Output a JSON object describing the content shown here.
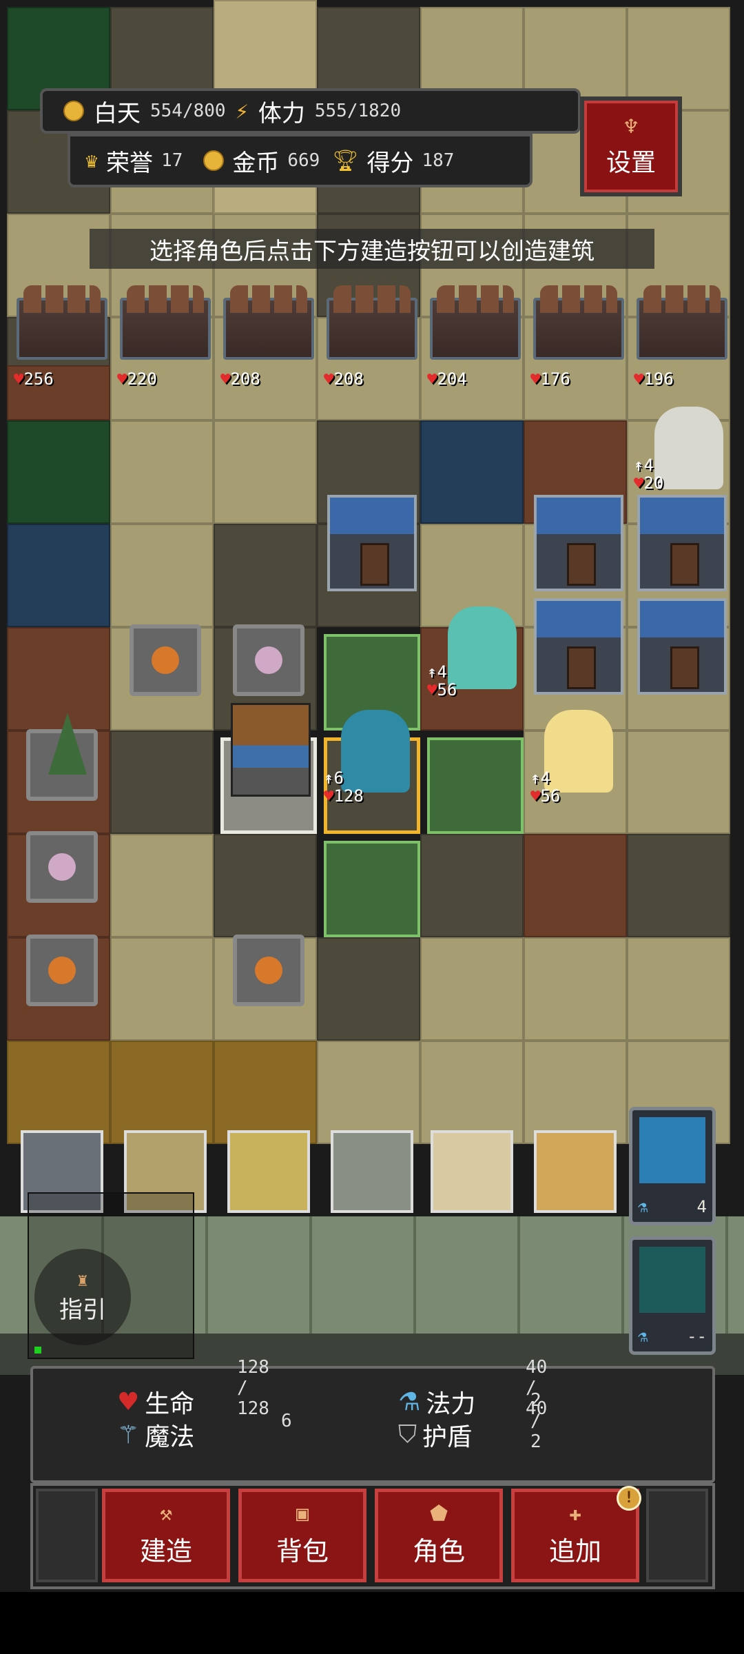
{
  "hud": {
    "day_label": "白天",
    "day_value": "554",
    "day_max": "800",
    "stamina_label": "体力",
    "stamina_value": "555",
    "stamina_max": "1820",
    "honor_label": "荣誉",
    "honor_value": "17",
    "gold_label": "金币",
    "gold_value": "669",
    "score_label": "得分",
    "score_value": "187",
    "settings_label": "设置"
  },
  "hint": "选择角色后点击下方建造按钮可以创造建筑",
  "walls_hp": [
    "256",
    "220",
    "208",
    "208",
    "204",
    "176",
    "196"
  ],
  "units": {
    "old_man": {
      "atk": "4",
      "hp": "20"
    },
    "teal_girl": {
      "atk": "4",
      "hp": "56"
    },
    "hero": {
      "atk": "6",
      "hp": "128"
    },
    "angel": {
      "atk": "4",
      "hp": "56"
    }
  },
  "skills": {
    "lightning_cost": "4",
    "shield_cost": "--"
  },
  "guide_label": "指引",
  "stats": {
    "life_label": "生命",
    "life_value": "128 / 128",
    "mana_label": "法力",
    "mana_value": "40 / 40",
    "magic_label": "魔法",
    "magic_value": "6",
    "shield_label": "护盾",
    "shield_value": "2 / 2"
  },
  "tabs": {
    "build": "建造",
    "bag": "背包",
    "role": "角色",
    "add": "追加"
  },
  "alert_mark": "!"
}
